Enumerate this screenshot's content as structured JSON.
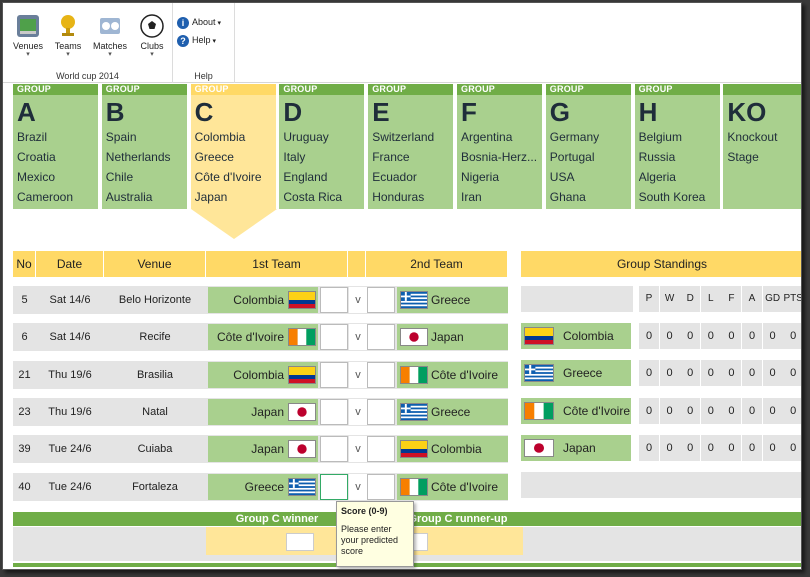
{
  "ribbon": {
    "buttons": [
      {
        "label": "Venues",
        "icon": "venues-icon"
      },
      {
        "label": "Teams",
        "icon": "trophy-icon"
      },
      {
        "label": "Matches",
        "icon": "matches-icon"
      },
      {
        "label": "Clubs",
        "icon": "football-icon"
      }
    ],
    "group1_label": "World cup 2014",
    "about_label": "About",
    "help_label": "Help",
    "group2_label": "Help"
  },
  "groups": [
    {
      "word": "GROUP",
      "letter": "A",
      "teams": [
        "Brazil",
        "Croatia",
        "Mexico",
        "Cameroon"
      ]
    },
    {
      "word": "GROUP",
      "letter": "B",
      "teams": [
        "Spain",
        "Netherlands",
        "Chile",
        "Australia"
      ]
    },
    {
      "word": "GROUP",
      "letter": "C",
      "teams": [
        "Colombia",
        "Greece",
        "Côte d'Ivoire",
        "Japan"
      ],
      "active": true
    },
    {
      "word": "GROUP",
      "letter": "D",
      "teams": [
        "Uruguay",
        "Italy",
        "England",
        "Costa Rica"
      ]
    },
    {
      "word": "GROUP",
      "letter": "E",
      "teams": [
        "Switzerland",
        "France",
        "Ecuador",
        "Honduras"
      ]
    },
    {
      "word": "GROUP",
      "letter": "F",
      "teams": [
        "Argentina",
        "Bosnia-Herz...",
        "Nigeria",
        "Iran"
      ]
    },
    {
      "word": "GROUP",
      "letter": "G",
      "teams": [
        "Germany",
        "Portugal",
        "USA",
        "Ghana"
      ]
    },
    {
      "word": "GROUP",
      "letter": "H",
      "teams": [
        "Belgium",
        "Russia",
        "Algeria",
        "South Korea"
      ]
    },
    {
      "word": "",
      "letter": "KO",
      "teams": [
        "Knockout",
        "Stage",
        "",
        ""
      ]
    }
  ],
  "match_headers": {
    "no": "No",
    "date": "Date",
    "venue": "Venue",
    "team1": "1st Team",
    "team2": "2nd Team"
  },
  "matches": [
    {
      "no": "5",
      "date": "Sat 14/6",
      "venue": "Belo Horizonte",
      "team1": "Colombia",
      "flag1": "colombia",
      "team2": "Greece",
      "flag2": "greece",
      "vs": "v"
    },
    {
      "no": "6",
      "date": "Sat 14/6",
      "venue": "Recife",
      "team1": "Côte d'Ivoire",
      "flag1": "ivory",
      "team2": "Japan",
      "flag2": "japan",
      "vs": "v"
    },
    {
      "no": "21",
      "date": "Thu 19/6",
      "venue": "Brasilia",
      "team1": "Colombia",
      "flag1": "colombia",
      "team2": "Côte d'Ivoire",
      "flag2": "ivory",
      "vs": "v"
    },
    {
      "no": "23",
      "date": "Thu 19/6",
      "venue": "Natal",
      "team1": "Japan",
      "flag1": "japan",
      "team2": "Greece",
      "flag2": "greece",
      "vs": "v"
    },
    {
      "no": "39",
      "date": "Tue 24/6",
      "venue": "Cuiaba",
      "team1": "Japan",
      "flag1": "japan",
      "team2": "Colombia",
      "flag2": "colombia",
      "vs": "v"
    },
    {
      "no": "40",
      "date": "Tue 24/6",
      "venue": "Fortaleza",
      "team1": "Greece",
      "flag1": "greece",
      "team2": "Côte d'Ivoire",
      "flag2": "ivory",
      "vs": "v"
    }
  ],
  "standings": {
    "title": "Group Standings",
    "columns": [
      "P",
      "W",
      "D",
      "L",
      "F",
      "A",
      "GD",
      "PTS"
    ],
    "rows": [
      {
        "team": "Colombia",
        "flag": "colombia",
        "values": [
          "0",
          "0",
          "0",
          "0",
          "0",
          "0",
          "0",
          "0"
        ]
      },
      {
        "team": "Greece",
        "flag": "greece",
        "values": [
          "0",
          "0",
          "0",
          "0",
          "0",
          "0",
          "0",
          "0"
        ]
      },
      {
        "team": "Côte d'Ivoire",
        "flag": "ivory",
        "values": [
          "0",
          "0",
          "0",
          "0",
          "0",
          "0",
          "0",
          "0"
        ]
      },
      {
        "team": "Japan",
        "flag": "japan",
        "values": [
          "0",
          "0",
          "0",
          "0",
          "0",
          "0",
          "0",
          "0"
        ]
      }
    ]
  },
  "winners": {
    "winner_label": "Group C winner",
    "runnerup_label": "Group C runner-up"
  },
  "tooltip": {
    "title": "Score (0-9)",
    "body": "Please enter your predicted score"
  },
  "colors": {
    "accent_green": "#70ad47",
    "light_green": "#a9d08e",
    "yellow": "#ffd966",
    "light_yellow": "#ffe699"
  }
}
